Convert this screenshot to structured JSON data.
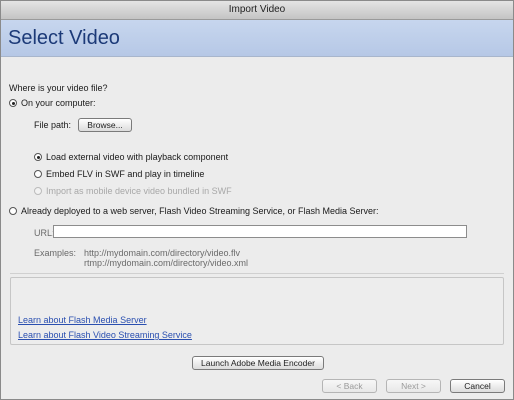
{
  "window": {
    "title": "Import Video"
  },
  "header": {
    "title": "Select Video"
  },
  "question": "Where is your video file?",
  "computer_option": {
    "label": "On your computer:",
    "selected": true
  },
  "file_path": {
    "label": "File path:",
    "browse_label": "Browse..."
  },
  "sub_options": [
    {
      "label": "Load external video with playback component",
      "selected": true,
      "disabled": false
    },
    {
      "label": "Embed FLV in SWF and play in timeline",
      "selected": false,
      "disabled": false
    },
    {
      "label": "Import as mobile device video bundled in SWF",
      "selected": false,
      "disabled": true
    }
  ],
  "server_option": {
    "label": "Already deployed to a web server, Flash Video Streaming Service, or Flash Media Server:",
    "selected": false
  },
  "url": {
    "label": "URL:",
    "value": ""
  },
  "examples": {
    "label": "Examples:",
    "line1": "http://mydomain.com/directory/video.flv",
    "line2": "rtmp://mydomain.com/directory/video.xml"
  },
  "links": {
    "flash_media_server": "Learn about Flash Media Server",
    "flash_video_streaming": "Learn about Flash Video Streaming Service"
  },
  "buttons": {
    "launch_encoder": "Launch Adobe Media Encoder",
    "back": "< Back",
    "next": "Next >",
    "cancel": "Cancel"
  }
}
